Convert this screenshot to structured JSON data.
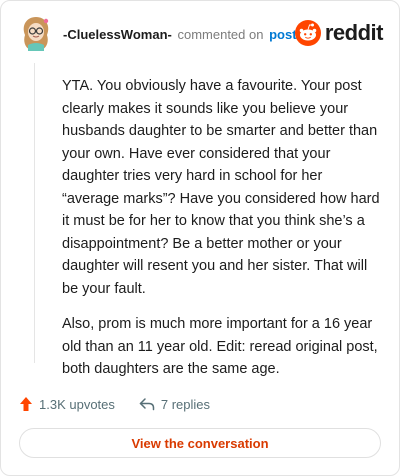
{
  "header": {
    "username": "-CluelessWoman-",
    "action": "commented on",
    "post_link": "post",
    "brand": "reddit"
  },
  "comment": {
    "paragraphs": [
      "YTA. You obviously have a favourite. Your post clearly makes it sounds like you believe your husbands daughter to be smarter and better than your own. Have ever considered that your daughter tries very hard in school for her “average marks”? Have you considered how hard it must be for her to know that you think she’s a disappointment? Be a better mother or your daughter will resent you and her sister. That will be your fault.",
      "Also, prom is much more important for a 16 year old than an 11 year old. Edit: reread original post, both daughters are the same age."
    ]
  },
  "actions": {
    "upvotes": "1.3K upvotes",
    "replies": "7 replies"
  },
  "cta": {
    "label": "View the conversation"
  },
  "colors": {
    "upvote": "#ff4500",
    "link": "#0079d3",
    "cta": "#d93a00",
    "muted": "#576f76"
  },
  "icons": [
    "avatar",
    "reddit-logo-icon",
    "upvote-arrow-icon",
    "reply-arrow-icon"
  ]
}
